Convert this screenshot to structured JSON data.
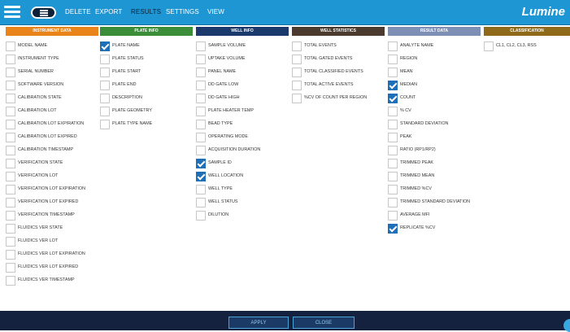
{
  "topbar": {
    "nav": {
      "delete": "DELETE",
      "export": "EXPORT",
      "results": "RESULTS",
      "settings": "SETTINGS",
      "view": "VIEW"
    },
    "brand": "Lumine"
  },
  "columns": [
    {
      "title": "INSTRUMENT DATA",
      "color": "#e8841a",
      "items": [
        {
          "label": "MODEL NAME",
          "checked": false
        },
        {
          "label": "INSTRUMENT TYPE",
          "checked": false
        },
        {
          "label": "SERIAL NUMBER",
          "checked": false
        },
        {
          "label": "SOFTWARE VERSION",
          "checked": false
        },
        {
          "label": "CALIBRATION STATE",
          "checked": false
        },
        {
          "label": "CALIBRATION LOT",
          "checked": false
        },
        {
          "label": "CALIBRATION LOT EXPIRATION",
          "checked": false
        },
        {
          "label": "CALIBRATION LOT EXPIRED",
          "checked": false
        },
        {
          "label": "CALIBRATION TIMESTAMP",
          "checked": false
        },
        {
          "label": "VERIFICATION STATE",
          "checked": false
        },
        {
          "label": "VERIFICATION LOT",
          "checked": false
        },
        {
          "label": "VERIFICATION LOT EXPIRATION",
          "checked": false
        },
        {
          "label": "VERIFICATION LOT EXPIRED",
          "checked": false
        },
        {
          "label": "VERIFICATION TIMESTAMP",
          "checked": false
        },
        {
          "label": "FLUIDICS VER STATE",
          "checked": false
        },
        {
          "label": "FLUIDICS VER LOT",
          "checked": false
        },
        {
          "label": "FLUIDICS VER LOT EXPIRATION",
          "checked": false
        },
        {
          "label": "FLUIDICS VER LOT EXPIRED",
          "checked": false
        },
        {
          "label": "FLUIDICS VER TIMESTAMP",
          "checked": false
        }
      ]
    },
    {
      "title": "PLATE INFO",
      "color": "#3c8d3a",
      "items": [
        {
          "label": "PLATE NAME",
          "checked": true
        },
        {
          "label": "PLATE STATUS",
          "checked": false
        },
        {
          "label": "PLATE START",
          "checked": false
        },
        {
          "label": "PLATE END",
          "checked": false
        },
        {
          "label": "DESCRIPTION",
          "checked": false
        },
        {
          "label": "PLATE GEOMETRY",
          "checked": false
        },
        {
          "label": "PLATE TYPE NAME",
          "checked": false
        }
      ]
    },
    {
      "title": "WELL INFO",
      "color": "#1b3a6b",
      "items": [
        {
          "label": "SAMPLE VOLUME",
          "checked": false
        },
        {
          "label": "UPTAKE VOLUME",
          "checked": false
        },
        {
          "label": "PANEL NAME",
          "checked": false
        },
        {
          "label": "DD GATE LOW",
          "checked": false
        },
        {
          "label": "DD GATE HIGH",
          "checked": false
        },
        {
          "label": "PLATE HEATER TEMP",
          "checked": false
        },
        {
          "label": "BEAD TYPE",
          "checked": false
        },
        {
          "label": "OPERATING MODE",
          "checked": false
        },
        {
          "label": "ACQUISITION DURATION",
          "checked": false
        },
        {
          "label": "SAMPLE ID",
          "checked": true
        },
        {
          "label": "WELL LOCATION",
          "checked": true
        },
        {
          "label": "WELL TYPE",
          "checked": false
        },
        {
          "label": "WELL STATUS",
          "checked": false
        },
        {
          "label": "DILUTION",
          "checked": false
        }
      ]
    },
    {
      "title": "WELL STATISTICS",
      "color": "#4a3b2e",
      "items": [
        {
          "label": "TOTAL EVENTS",
          "checked": false
        },
        {
          "label": "TOTAL GATED EVENTS",
          "checked": false
        },
        {
          "label": "TOTAL CLASSIFIED EVENTS",
          "checked": false
        },
        {
          "label": "TOTAL ACTIVE EVENTS",
          "checked": false
        },
        {
          "label": "%CV OF COUNT PER REGION",
          "checked": false
        }
      ]
    },
    {
      "title": "RESULT DATA",
      "color": "#7d8fb5",
      "items": [
        {
          "label": "ANALYTE NAME",
          "checked": false
        },
        {
          "label": "REGION",
          "checked": false
        },
        {
          "label": "MEAN",
          "checked": false
        },
        {
          "label": "MEDIAN",
          "checked": true
        },
        {
          "label": "COUNT",
          "checked": true
        },
        {
          "label": "% CV",
          "checked": false
        },
        {
          "label": "STANDARD DEVIATION",
          "checked": false
        },
        {
          "label": "PEAK",
          "checked": false
        },
        {
          "label": "RATIO (RP1/RP2)",
          "checked": false
        },
        {
          "label": "TRIMMED PEAK",
          "checked": false
        },
        {
          "label": "TRIMMED MEAN",
          "checked": false
        },
        {
          "label": "TRIMMED %CV",
          "checked": false
        },
        {
          "label": "TRIMMED STANDARD DEVIATION",
          "checked": false
        },
        {
          "label": "AVERAGE MFI",
          "checked": false
        },
        {
          "label": "REPLICATE %CV",
          "checked": true
        }
      ]
    },
    {
      "title": "CLASSIFICATION",
      "color": "#8f6a1a",
      "items": [
        {
          "label": "CL1, CL2, CL3, RSS",
          "checked": false
        }
      ]
    }
  ],
  "footer": {
    "apply": "APPLY",
    "close": "CLOSE"
  }
}
